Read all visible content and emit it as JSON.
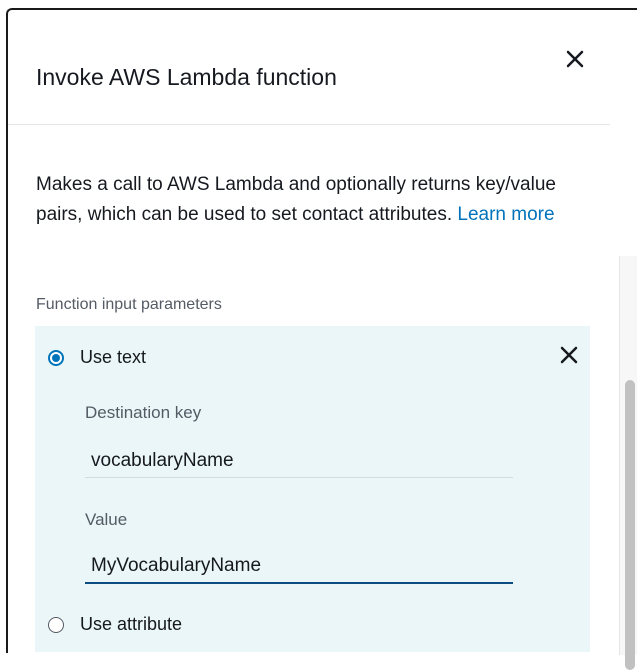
{
  "modal": {
    "title": "Invoke AWS Lambda function",
    "close_icon": "close-icon",
    "description": "Makes a call to AWS Lambda and optionally returns key/value pairs, which can be used to set contact attributes.",
    "learn_more": "Learn more"
  },
  "params": {
    "section_label": "Function input parameters",
    "options": [
      {
        "label": "Use text",
        "selected": true
      },
      {
        "label": "Use attribute",
        "selected": false
      }
    ],
    "remove_icon": "close-icon",
    "destination_key": {
      "label": "Destination key",
      "value": "vocabularyName"
    },
    "value_field": {
      "label": "Value",
      "value": "MyVocabularyName"
    }
  },
  "colors": {
    "accent": "#0073bb",
    "param_background": "#eaf6f8",
    "text": "#16191f",
    "muted_text": "#545b64"
  }
}
